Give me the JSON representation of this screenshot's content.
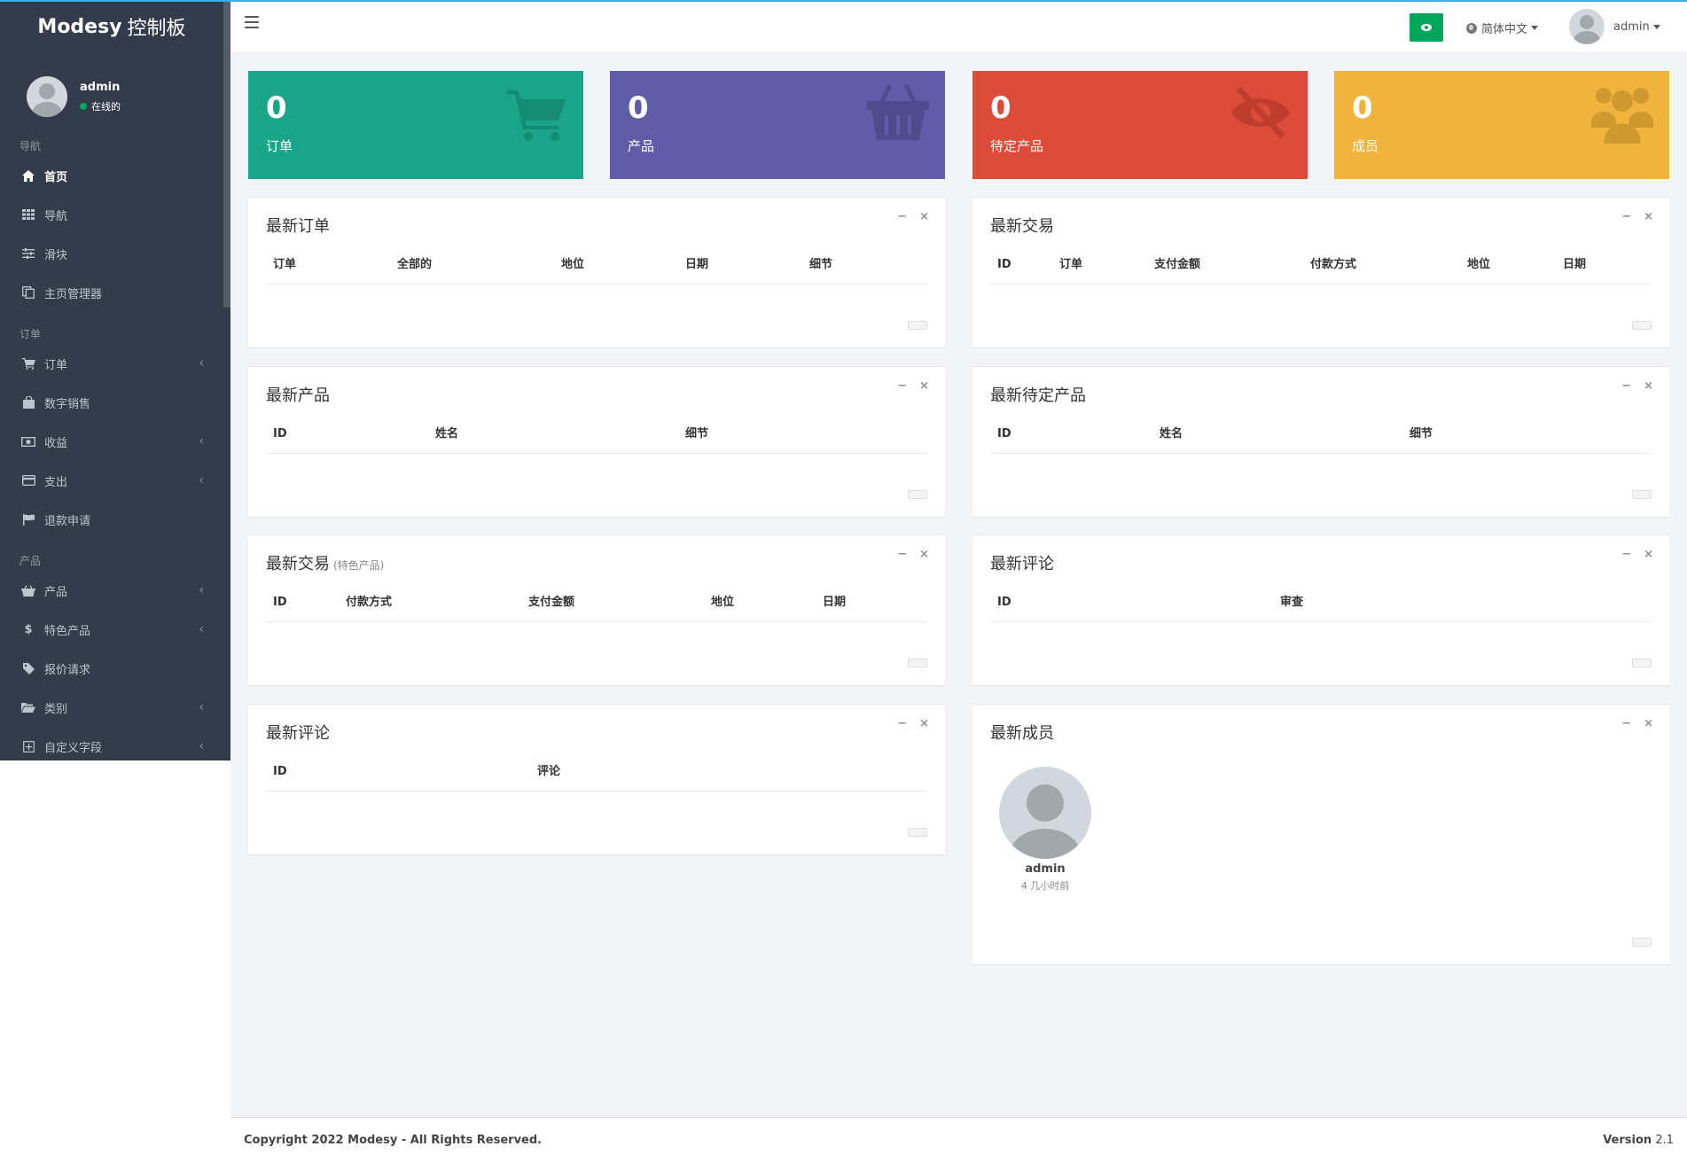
{
  "brand": {
    "name_bold": "Modesy",
    "name_rest": "控制板"
  },
  "user": {
    "name": "admin",
    "status": "在线的"
  },
  "sidebar": {
    "sections": [
      {
        "header": "导航",
        "items": [
          {
            "label": "首页",
            "icon": "home-icon",
            "active": true,
            "chevron": false
          },
          {
            "label": "导航",
            "icon": "grid-icon",
            "active": false,
            "chevron": false
          },
          {
            "label": "滑块",
            "icon": "sliders-icon",
            "active": false,
            "chevron": false
          },
          {
            "label": "主页管理器",
            "icon": "copy-icon",
            "active": false,
            "chevron": false
          }
        ]
      },
      {
        "header": "订单",
        "items": [
          {
            "label": "订单",
            "icon": "cart-icon",
            "active": false,
            "chevron": true
          },
          {
            "label": "数字销售",
            "icon": "shopping-bag-icon",
            "active": false,
            "chevron": false
          },
          {
            "label": "收益",
            "icon": "money-icon",
            "active": false,
            "chevron": true
          },
          {
            "label": "支出",
            "icon": "credit-card-icon",
            "active": false,
            "chevron": true
          },
          {
            "label": "退款申请",
            "icon": "flag-icon",
            "active": false,
            "chevron": false
          }
        ]
      },
      {
        "header": "产品",
        "items": [
          {
            "label": "产品",
            "icon": "basket-icon",
            "active": false,
            "chevron": true
          },
          {
            "label": "特色产品",
            "icon": "dollar-icon",
            "active": false,
            "chevron": true
          },
          {
            "label": "报价请求",
            "icon": "tag-icon",
            "active": false,
            "chevron": false
          },
          {
            "label": "类别",
            "icon": "folder-open-icon",
            "active": false,
            "chevron": true
          },
          {
            "label": "自定义字段",
            "icon": "plus-square-icon",
            "active": false,
            "chevron": true
          }
        ]
      }
    ]
  },
  "header": {
    "language": "简体中文",
    "user_name": "admin"
  },
  "stats": [
    {
      "value": "0",
      "label": "订单",
      "color": "#1aa58a",
      "icon": "cart-icon"
    },
    {
      "value": "0",
      "label": "产品",
      "color": "#605ca8",
      "icon": "basket-icon"
    },
    {
      "value": "0",
      "label": "待定产品",
      "color": "#dd4b39",
      "icon": "eye-slash-icon"
    },
    {
      "value": "0",
      "label": "成员",
      "color": "#f0b43c",
      "icon": "users-icon"
    }
  ],
  "boxes": {
    "latest_orders": {
      "title": "最新订单",
      "columns": [
        "订单",
        "全部的",
        "地位",
        "日期",
        "细节"
      ]
    },
    "latest_transactions": {
      "title": "最新交易",
      "columns": [
        "ID",
        "订单",
        "支付金额",
        "付款方式",
        "地位",
        "日期"
      ]
    },
    "latest_products": {
      "title": "最新产品",
      "columns": [
        "ID",
        "姓名",
        "细节"
      ]
    },
    "latest_pending_products": {
      "title": "最新待定产品",
      "columns": [
        "ID",
        "姓名",
        "细节"
      ]
    },
    "latest_featured_transactions": {
      "title": "最新交易",
      "subtitle": "(特色产品)",
      "columns": [
        "ID",
        "付款方式",
        "支付金额",
        "地位",
        "日期"
      ]
    },
    "latest_reviews": {
      "title": "最新评论",
      "columns": [
        "ID",
        "审查"
      ]
    },
    "latest_comments": {
      "title": "最新评论",
      "columns": [
        "ID",
        "评论"
      ]
    },
    "latest_members": {
      "title": "最新成员",
      "members": [
        {
          "name": "admin",
          "time": "4 几小时前"
        }
      ]
    }
  },
  "box_tools": {
    "collapse": "−",
    "remove": "×"
  },
  "footer": {
    "copyright": "Copyright 2022 Modesy - All Rights Reserved.",
    "version_label": "Version",
    "version_number": "2.1"
  }
}
